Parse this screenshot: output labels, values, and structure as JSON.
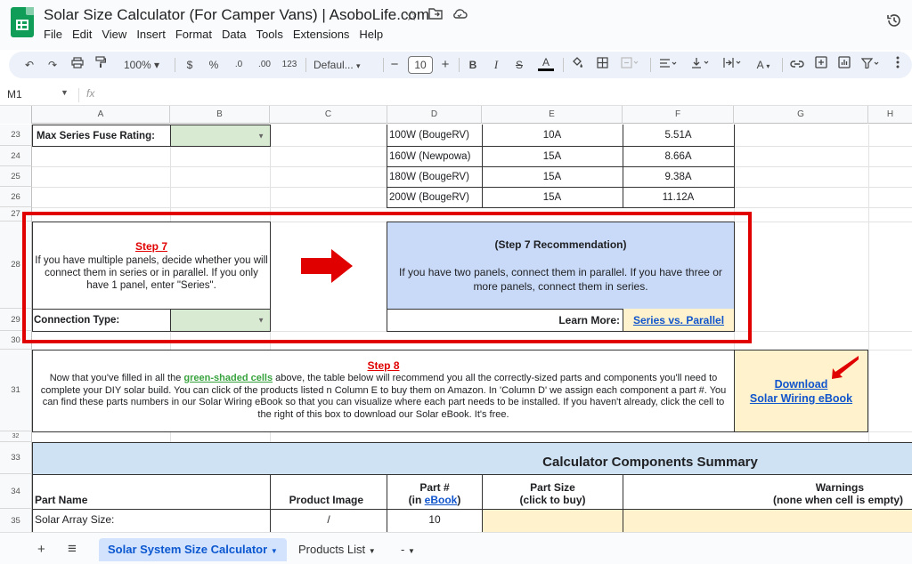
{
  "app": {
    "title": "Solar Size Calculator (For Camper Vans) | AsoboLife.com",
    "menu": [
      "File",
      "Edit",
      "View",
      "Insert",
      "Format",
      "Data",
      "Tools",
      "Extensions",
      "Help"
    ]
  },
  "toolbar": {
    "zoom": "100%",
    "currency": "$",
    "percent": "%",
    "dec_decrease": ".0",
    "dec_increase": ".00",
    "number_format": "123",
    "font": "Defaul...",
    "font_size": "10",
    "minus": "−",
    "plus": "+"
  },
  "formula": {
    "cell_ref": "M1",
    "fx": "fx",
    "value": ""
  },
  "columns": [
    "A",
    "B",
    "C",
    "D",
    "E",
    "F",
    "G",
    "H"
  ],
  "rows": [
    "23",
    "24",
    "25",
    "26",
    "27",
    "28",
    "29",
    "30",
    "31",
    "32",
    "33",
    "34",
    "35"
  ],
  "sheet": {
    "fuse_label": "Max Series Fuse Rating:",
    "panel_table": [
      {
        "panel": "100W (BougeRV)",
        "fuse": "10A",
        "current": "5.51A"
      },
      {
        "panel": "160W (Newpowa)",
        "fuse": "15A",
        "current": "8.66A"
      },
      {
        "panel": "180W (BougeRV)",
        "fuse": "15A",
        "current": "9.38A"
      },
      {
        "panel": "200W (BougeRV)",
        "fuse": "15A",
        "current": "11.12A"
      }
    ],
    "step7_title": "Step 7",
    "step7_text": "If you have multiple panels, decide whether you will connect them in series or in parallel. If you only have 1 panel, enter \"Series\".",
    "connection_label": "Connection Type:",
    "rec_title": "(Step 7 Recommendation)",
    "rec_text": "If you have two panels, connect them in parallel. If you have three or more panels, connect them in series.",
    "learn_more_label": "Learn More:",
    "learn_more_link": "Series vs. Parallel",
    "step8_title": "Step 8",
    "step8_text_pre": "Now that you've filled in all the ",
    "step8_green": "green-shaded cells",
    "step8_text_post": " above, the table below will recommend you all the correctly-sized parts and components you'll need to complete your DIY solar build. You can click of the products listed n Column E to buy them on Amazon. In 'Column D' we assign each component a part #. You can find these parts numbers in our Solar Wiring eBook so that you can visualize where each part needs to be installed. If you haven't already, click the cell to the right of this box to download our Solar eBook. It's free.",
    "download_line1": "Download",
    "download_line2": "Solar Wiring eBook",
    "summary_title": "Calculator Components Summary",
    "hdr_part_name": "Part Name",
    "hdr_product_image": "Product Image",
    "hdr_part_num_1": "Part #",
    "hdr_part_num_2a": "(in ",
    "hdr_part_num_link": "eBook",
    "hdr_part_num_2b": ")",
    "hdr_part_size_1": "Part Size",
    "hdr_part_size_2": "(click to buy)",
    "hdr_warnings_1": "Warnings",
    "hdr_warnings_2": "(none when cell is empty)",
    "row35_name": "Solar Array Size:",
    "row35_image": "/",
    "row35_num": "10"
  },
  "tabs": {
    "add": "+",
    "list": "≡",
    "items": [
      "Solar System Size Calculator",
      "Products List",
      "-"
    ],
    "active": "Solar System Size Calculator"
  },
  "colors": {
    "accent_red": "#e00000",
    "link_blue": "#1155cc",
    "green_fill": "#d9ead3",
    "blue_fill": "#c9daf8",
    "yellow_fill": "#fff2cc",
    "header_blue": "#cfe2f3",
    "active_tab": "#d3e3fd"
  },
  "icons": [
    "star-icon",
    "move-to-folder-icon",
    "cloud-status-icon",
    "history-icon",
    "undo-icon",
    "redo-icon",
    "print-icon",
    "paint-format-icon",
    "arrow-right-icon"
  ]
}
